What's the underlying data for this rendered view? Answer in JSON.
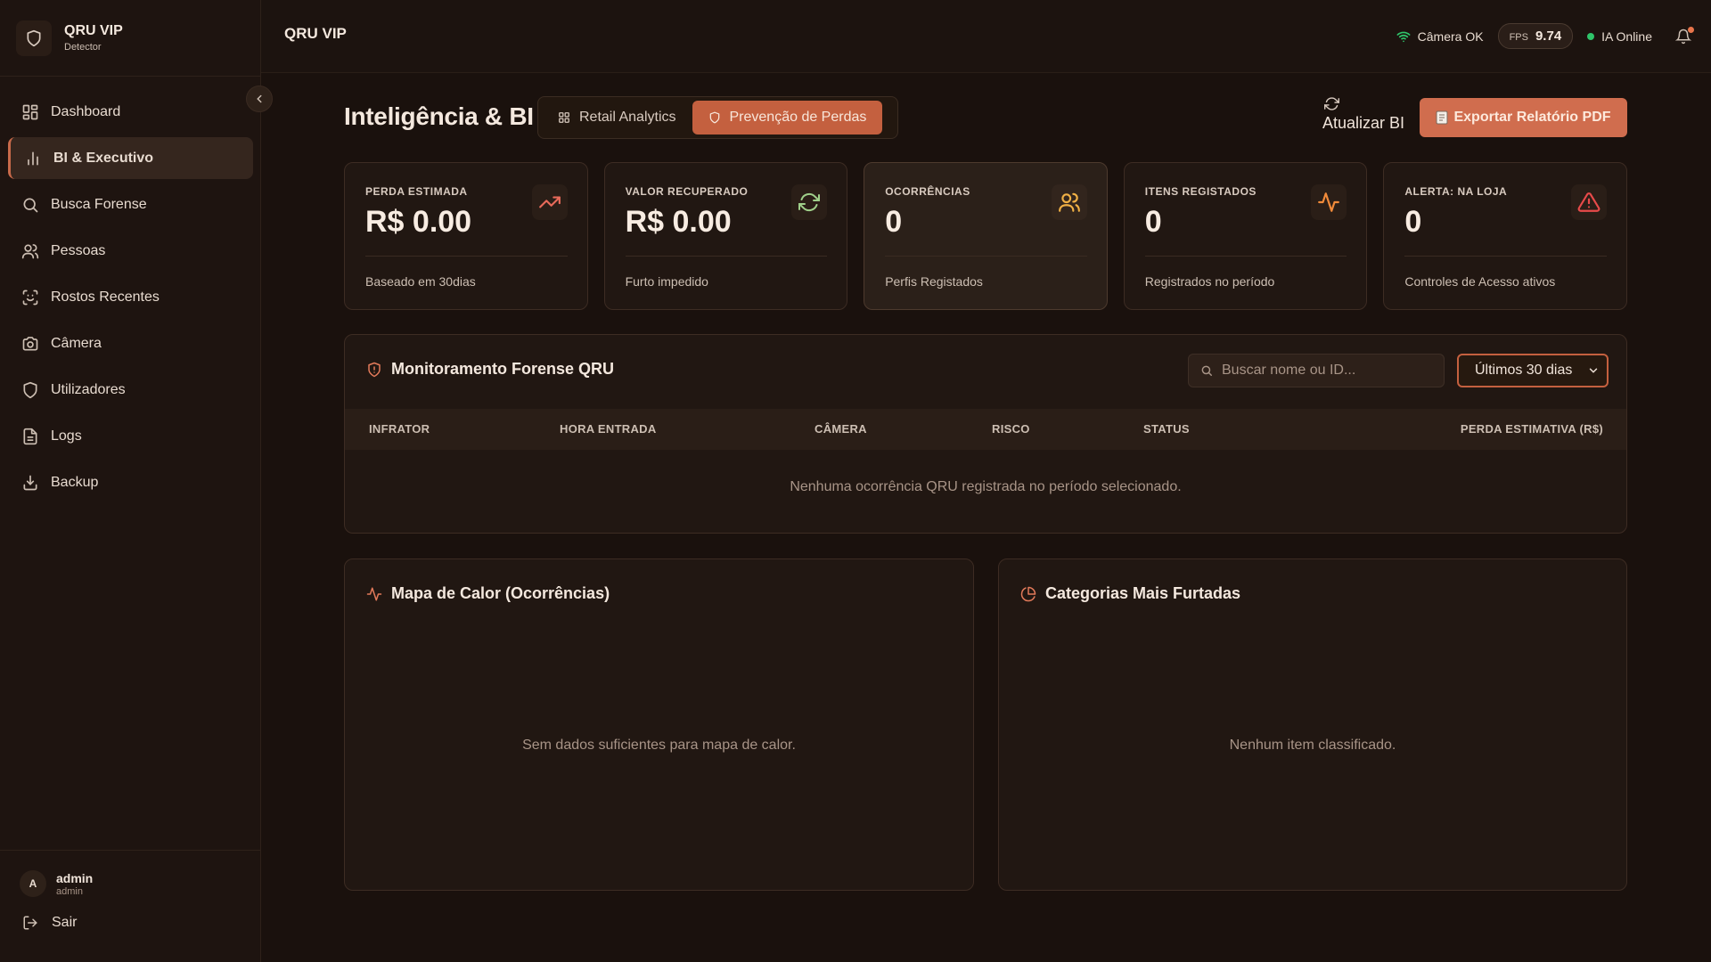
{
  "colors": {
    "background": "#1a110d",
    "accent": "#c4603f",
    "accent_button": "#d06d4e",
    "online": "#2fc46a"
  },
  "brand": {
    "title": "QRU VIP",
    "subtitle": "Detector",
    "icon": "shield-icon"
  },
  "sidebar": {
    "items": [
      {
        "label": "Dashboard",
        "icon": "grid-icon"
      },
      {
        "label": "BI & Executivo",
        "icon": "bar-chart-icon",
        "active": true
      },
      {
        "label": "Busca Forense",
        "icon": "search-icon"
      },
      {
        "label": "Pessoas",
        "icon": "users-icon"
      },
      {
        "label": "Rostos Recentes",
        "icon": "face-scan-icon"
      },
      {
        "label": "Câmera",
        "icon": "camera-icon"
      },
      {
        "label": "Utilizadores",
        "icon": "shield-icon"
      },
      {
        "label": "Logs",
        "icon": "file-text-icon"
      },
      {
        "label": "Backup",
        "icon": "download-icon"
      }
    ],
    "user": {
      "initial": "A",
      "name": "admin",
      "role": "admin"
    },
    "logout_label": "Sair"
  },
  "topbar": {
    "title": "QRU VIP",
    "camera_status": "Câmera OK",
    "fps_label": "FPS",
    "fps_value": "9.74",
    "ai_status": "IA Online"
  },
  "page": {
    "title": "Inteligência & BI",
    "tabs": [
      {
        "label": "Retail Analytics",
        "icon": "grid-icon"
      },
      {
        "label": "Prevenção de Perdas",
        "icon": "shield-icon",
        "active": true
      }
    ],
    "refresh_label": "Atualizar BI",
    "export_label": "Exportar Relatório PDF"
  },
  "kpis": [
    {
      "label": "PERDA ESTIMADA",
      "value": "R$ 0.00",
      "sub": "Baseado em 30dias",
      "icon": "trending-up-icon",
      "color": "#e86a5a"
    },
    {
      "label": "VALOR RECUPERADO",
      "value": "R$ 0.00",
      "sub": "Furto impedido",
      "icon": "refresh-icon",
      "color": "#9fcf8a"
    },
    {
      "label": "OCORRÊNCIAS",
      "value": "0",
      "sub": "Perfis Registados",
      "icon": "users-icon",
      "color": "#f0b045"
    },
    {
      "label": "ITENS REGISTADOS",
      "value": "0",
      "sub": "Registrados no período",
      "icon": "activity-icon",
      "color": "#f08a3a"
    },
    {
      "label": "ALERTA: NA LOJA",
      "value": "0",
      "sub": "Controles de Acesso ativos",
      "icon": "alert-triangle-icon",
      "color": "#e84a4a"
    }
  ],
  "forensic": {
    "title": "Monitoramento Forense QRU",
    "search_placeholder": "Buscar nome ou ID...",
    "period": "Últimos 30 dias",
    "columns": [
      "INFRATOR",
      "HORA ENTRADA",
      "CÂMERA",
      "RISCO",
      "STATUS",
      "PERDA ESTIMATIVA (R$)"
    ],
    "empty": "Nenhuma ocorrência QRU registrada no período selecionado."
  },
  "heatmap": {
    "title": "Mapa de Calor (Ocorrências)",
    "empty": "Sem dados suficientes para mapa de calor."
  },
  "categories": {
    "title": "Categorias Mais Furtadas",
    "empty": "Nenhum item classificado."
  }
}
